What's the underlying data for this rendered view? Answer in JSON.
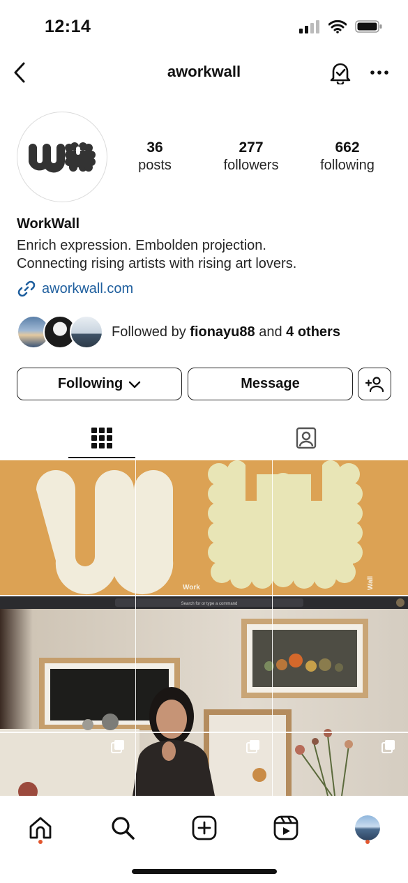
{
  "status_bar": {
    "time": "12:14",
    "icons": [
      "signal-icon",
      "wifi-icon",
      "battery-icon"
    ]
  },
  "topbar": {
    "username": "aworkwall",
    "icons": [
      "back-icon",
      "notification-bell-icon",
      "more-icon"
    ]
  },
  "profile": {
    "avatar_logo_text": "WW",
    "stats": [
      {
        "value": "36",
        "label": "posts"
      },
      {
        "value": "277",
        "label": "followers"
      },
      {
        "value": "662",
        "label": "following"
      }
    ],
    "name": "WorkWall",
    "bio_lines": [
      "Enrich expression. Embolden projection.",
      "Connecting rising artists with rising art lovers."
    ],
    "link": "aworkwall.com"
  },
  "followed_by": {
    "prefix": "Followed by",
    "user": "fionayu88",
    "connector": "and",
    "others": "4 others"
  },
  "actions": {
    "following_label": "Following",
    "message_label": "Message"
  },
  "tabs": [
    "grid-icon",
    "tagged-icon"
  ],
  "grid": {
    "post1_labels": {
      "work": "Work",
      "wall": "Wall"
    },
    "post2_search_placeholder": "Search for or type a command"
  },
  "bottom_nav": [
    "home-icon",
    "search-icon",
    "new-post-icon",
    "reels-icon",
    "profile-avatar"
  ],
  "colors": {
    "accent_link": "#1f5f9e",
    "post_orange": "#dca254",
    "notification_dot": "#e2562e"
  }
}
